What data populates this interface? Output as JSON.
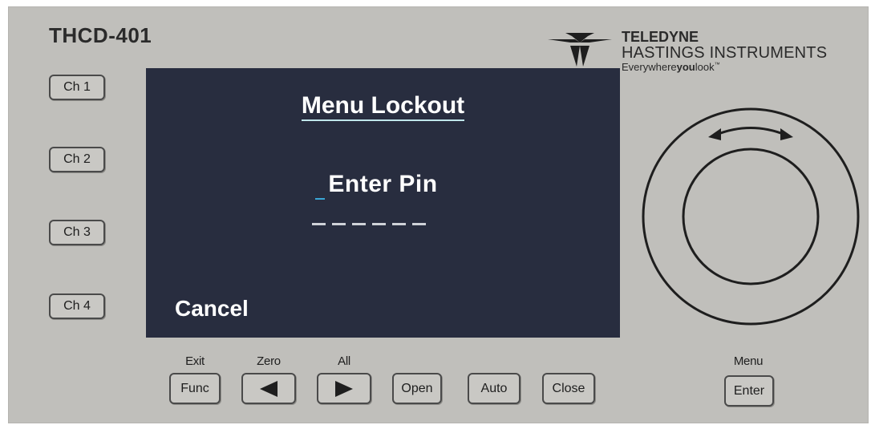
{
  "device": {
    "model": "THCD-401",
    "brand": {
      "name": "TELEDYNE",
      "subtitle": "HASTINGS INSTRUMENTS",
      "tagline_pre": "Everywhere",
      "tagline_bold": "you",
      "tagline_post": "look",
      "tagline_tm": "™"
    }
  },
  "channel_buttons": [
    {
      "label": "Ch 1"
    },
    {
      "label": "Ch 2"
    },
    {
      "label": "Ch 3"
    },
    {
      "label": "Ch 4"
    }
  ],
  "screen": {
    "title": "Menu Lockout",
    "prompt": "Enter Pin",
    "pin_slots": 6,
    "cancel": "Cancel"
  },
  "bottom_buttons": {
    "func": {
      "label": "Func",
      "caption": "Exit"
    },
    "left": {
      "icon": "left-arrow-icon",
      "caption": "Zero"
    },
    "right": {
      "icon": "right-arrow-icon",
      "caption": "All"
    },
    "open": {
      "label": "Open"
    },
    "auto": {
      "label": "Auto"
    },
    "close": {
      "label": "Close"
    },
    "enter": {
      "label": "Enter",
      "caption": "Menu"
    }
  },
  "knob": {
    "icon": "rotate-arrows-icon"
  },
  "colors": {
    "panel": "#c0bfbb",
    "screen_bg": "#282d3f",
    "screen_text": "#ffffff",
    "title_underline": "#bfe6ea",
    "cursor": "#3aa6d6"
  }
}
